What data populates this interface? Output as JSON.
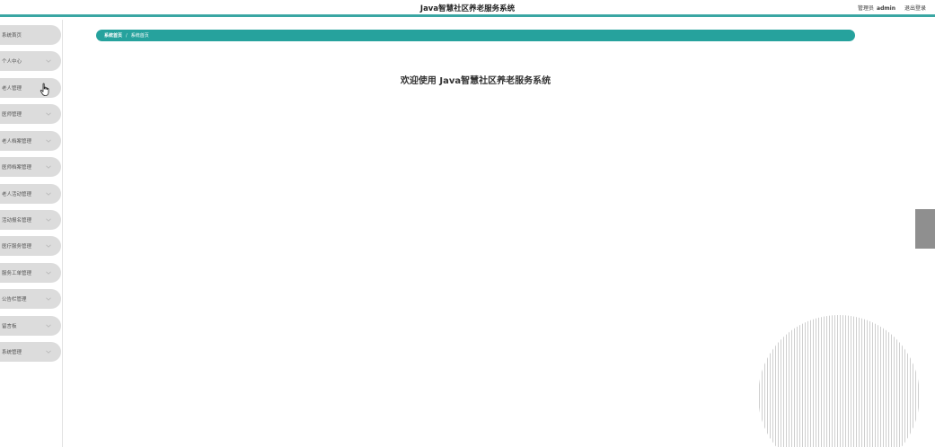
{
  "header": {
    "title": "Java智慧社区养老服务系统",
    "role_label": "管理员",
    "username": "admin",
    "logout_label": "退出登录"
  },
  "sidebar": {
    "items": [
      {
        "label": "系统首页",
        "has_chevron": false
      },
      {
        "label": "个人中心",
        "has_chevron": true
      },
      {
        "label": "老人管理",
        "has_chevron": false
      },
      {
        "label": "医师管理",
        "has_chevron": true
      },
      {
        "label": "老人档案管理",
        "has_chevron": true
      },
      {
        "label": "医师档案管理",
        "has_chevron": true
      },
      {
        "label": "老人活动管理",
        "has_chevron": true
      },
      {
        "label": "活动报名管理",
        "has_chevron": true
      },
      {
        "label": "医疗服务管理",
        "has_chevron": true
      },
      {
        "label": "服务工单管理",
        "has_chevron": true
      },
      {
        "label": "公告栏管理",
        "has_chevron": true
      },
      {
        "label": "留言板",
        "has_chevron": true
      },
      {
        "label": "系统管理",
        "has_chevron": true
      }
    ]
  },
  "breadcrumb": {
    "home": "系统首页",
    "separator": "/",
    "current": "系统首页"
  },
  "main": {
    "welcome_text": "欢迎使用 Java智慧社区养老服务系统"
  },
  "colors": {
    "accent": "#26a29d",
    "menu_bg": "#dcdcdc"
  }
}
